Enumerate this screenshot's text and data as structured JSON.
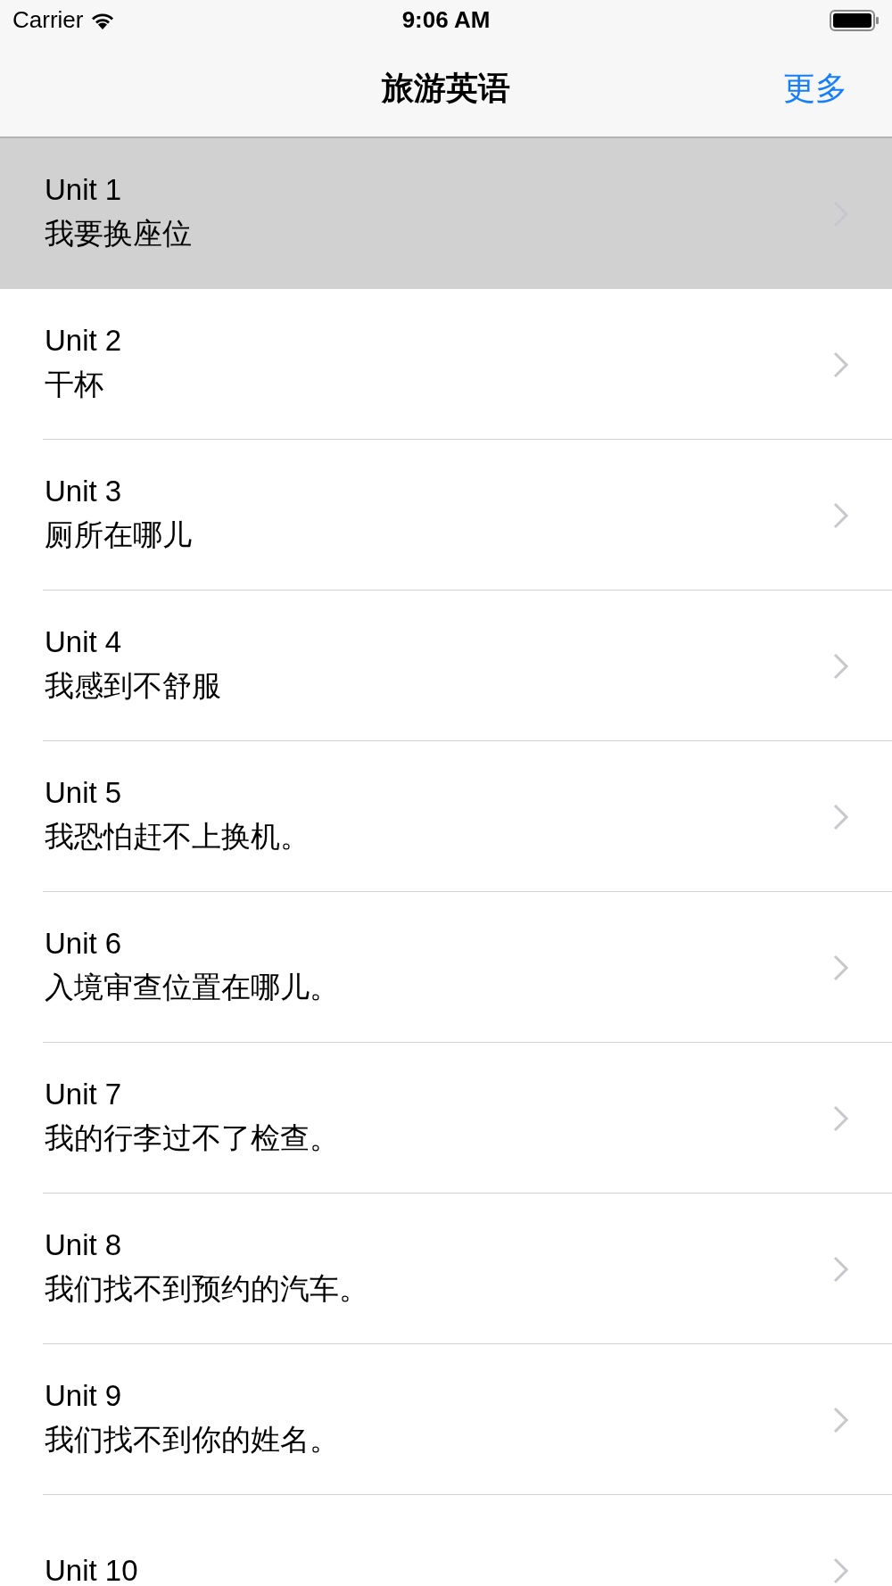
{
  "status_bar": {
    "carrier": "Carrier",
    "time": "9:06 AM"
  },
  "nav": {
    "title": "旅游英语",
    "action": "更多"
  },
  "units": [
    {
      "title": "Unit 1",
      "subtitle": "我要换座位",
      "selected": true
    },
    {
      "title": "Unit 2",
      "subtitle": "干杯",
      "selected": false
    },
    {
      "title": "Unit 3",
      "subtitle": "厕所在哪儿",
      "selected": false
    },
    {
      "title": "Unit 4",
      "subtitle": "我感到不舒服",
      "selected": false
    },
    {
      "title": "Unit 5",
      "subtitle": "我恐怕赶不上换机。",
      "selected": false
    },
    {
      "title": "Unit 6",
      "subtitle": "入境审查位置在哪儿。",
      "selected": false
    },
    {
      "title": "Unit 7",
      "subtitle": "我的行李过不了检查。",
      "selected": false
    },
    {
      "title": "Unit 8",
      "subtitle": "我们找不到预约的汽车。",
      "selected": false
    },
    {
      "title": "Unit 9",
      "subtitle": "我们找不到你的姓名。",
      "selected": false
    },
    {
      "title": "Unit 10",
      "selected": false
    }
  ]
}
